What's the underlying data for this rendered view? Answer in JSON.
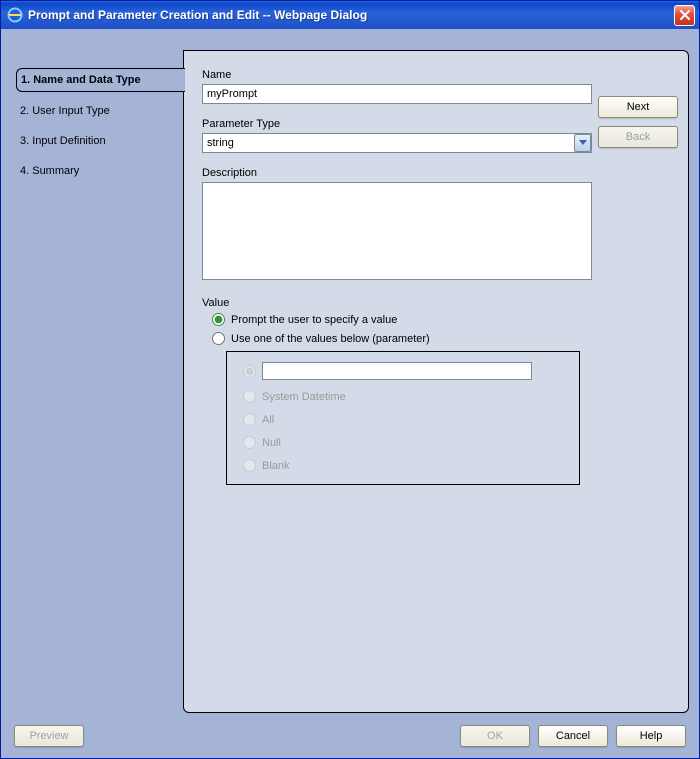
{
  "window": {
    "title": "Prompt and Parameter Creation and Edit -- Webpage Dialog"
  },
  "sidebar": {
    "steps": [
      {
        "label": "1. Name and Data Type",
        "active": true
      },
      {
        "label": "2. User Input Type",
        "active": false
      },
      {
        "label": "3. Input Definition",
        "active": false
      },
      {
        "label": "4. Summary",
        "active": false
      }
    ]
  },
  "nav": {
    "next": "Next",
    "back": "Back"
  },
  "form": {
    "name_label": "Name",
    "name_value": "myPrompt",
    "param_type_label": "Parameter Type",
    "param_type_value": "string",
    "description_label": "Description",
    "description_value": "",
    "value_label": "Value",
    "radio_prompt": "Prompt the user to specify a value",
    "radio_useone": "Use one of the values below (parameter)",
    "nested": {
      "custom_value": "",
      "system_datetime": "System Datetime",
      "all": "All",
      "null": "Null",
      "blank": "Blank"
    }
  },
  "footer": {
    "preview": "Preview",
    "ok": "OK",
    "cancel": "Cancel",
    "help": "Help"
  }
}
